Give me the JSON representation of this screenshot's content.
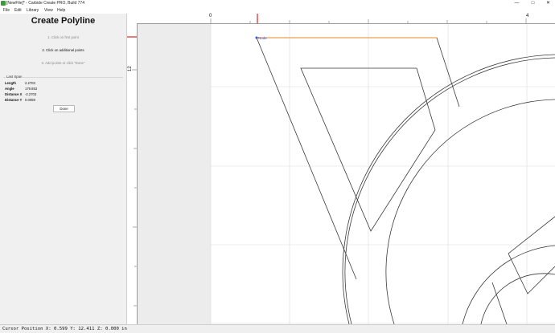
{
  "window": {
    "title": "[NewFile]* - Carbide Create PRO, Build 774",
    "minimize_glyph": "—",
    "maximize_glyph": "□",
    "close_glyph": "✕"
  },
  "menu": {
    "items": [
      "File",
      "Edit",
      "Library",
      "View",
      "Help"
    ]
  },
  "panel": {
    "title": "Create Polyline",
    "steps": [
      "1. Click on first point",
      "2. Click on additional points",
      "3. Add points or click \"Done\""
    ],
    "active_step": 1,
    "last_span": {
      "label": "Last Span",
      "rows": [
        {
          "key": "Length",
          "value": "2.2703"
        },
        {
          "key": "Angle",
          "value": "179.853"
        },
        {
          "key": "Distance X",
          "value": "-2.2703"
        },
        {
          "key": "Distance Y",
          "value": "0.0059"
        }
      ]
    },
    "done_label": "Done"
  },
  "rulers": {
    "top_labels": [
      "0",
      "4"
    ],
    "left_labels": [
      "12"
    ]
  },
  "canvas": {
    "node_label": "Node",
    "colors": {
      "guide_red": "#e02020",
      "active_segment": "#e88a2a",
      "vector_line": "#3a3a3a",
      "grid": "#dcdcdc",
      "offcanvas": "#ececec",
      "node": "#3a55d6"
    }
  },
  "status": {
    "text": "Cursor Position X: 0.599 Y: 12.411 Z: 0.000 in"
  }
}
